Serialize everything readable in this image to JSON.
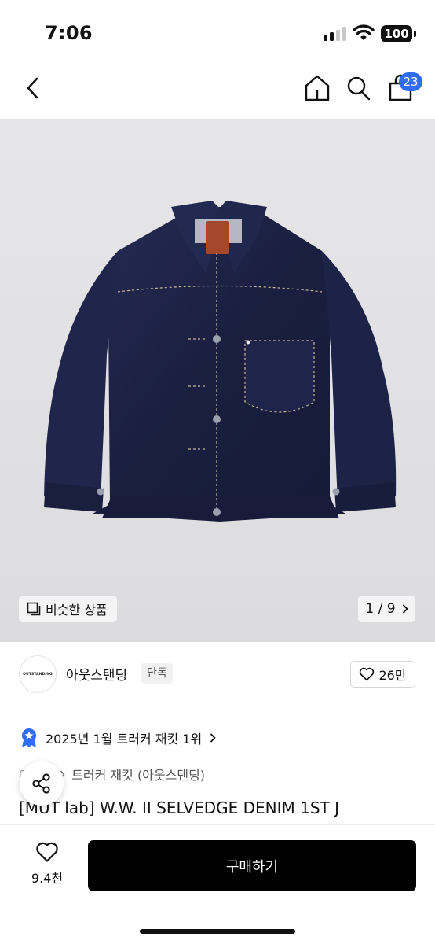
{
  "status_bar": {
    "time": "7:06",
    "battery": "100"
  },
  "nav": {
    "cart_count": "23"
  },
  "gallery": {
    "similar_label": "비슷한 상품",
    "page_counter": "1 / 9"
  },
  "brand": {
    "logo_text": "OUTSTANDING",
    "name": "아웃스탠딩",
    "exclusive_tag": "단독",
    "like_count": "26만"
  },
  "ranking": {
    "text": "2025년 1월 트러커 재킷 1위"
  },
  "breadcrumb": {
    "items": [
      "아우터",
      "트러커 재킷 (아웃스탠딩)"
    ]
  },
  "product": {
    "title": "[MUT lab] W.W. II SELVEDGE DENIM 1ST J"
  },
  "bottom": {
    "wish_count": "9.4천",
    "buy_label": "구매하기"
  },
  "colors": {
    "accent": "#2f6df6",
    "buy_button": "#000000",
    "denim": "#1c2244"
  }
}
